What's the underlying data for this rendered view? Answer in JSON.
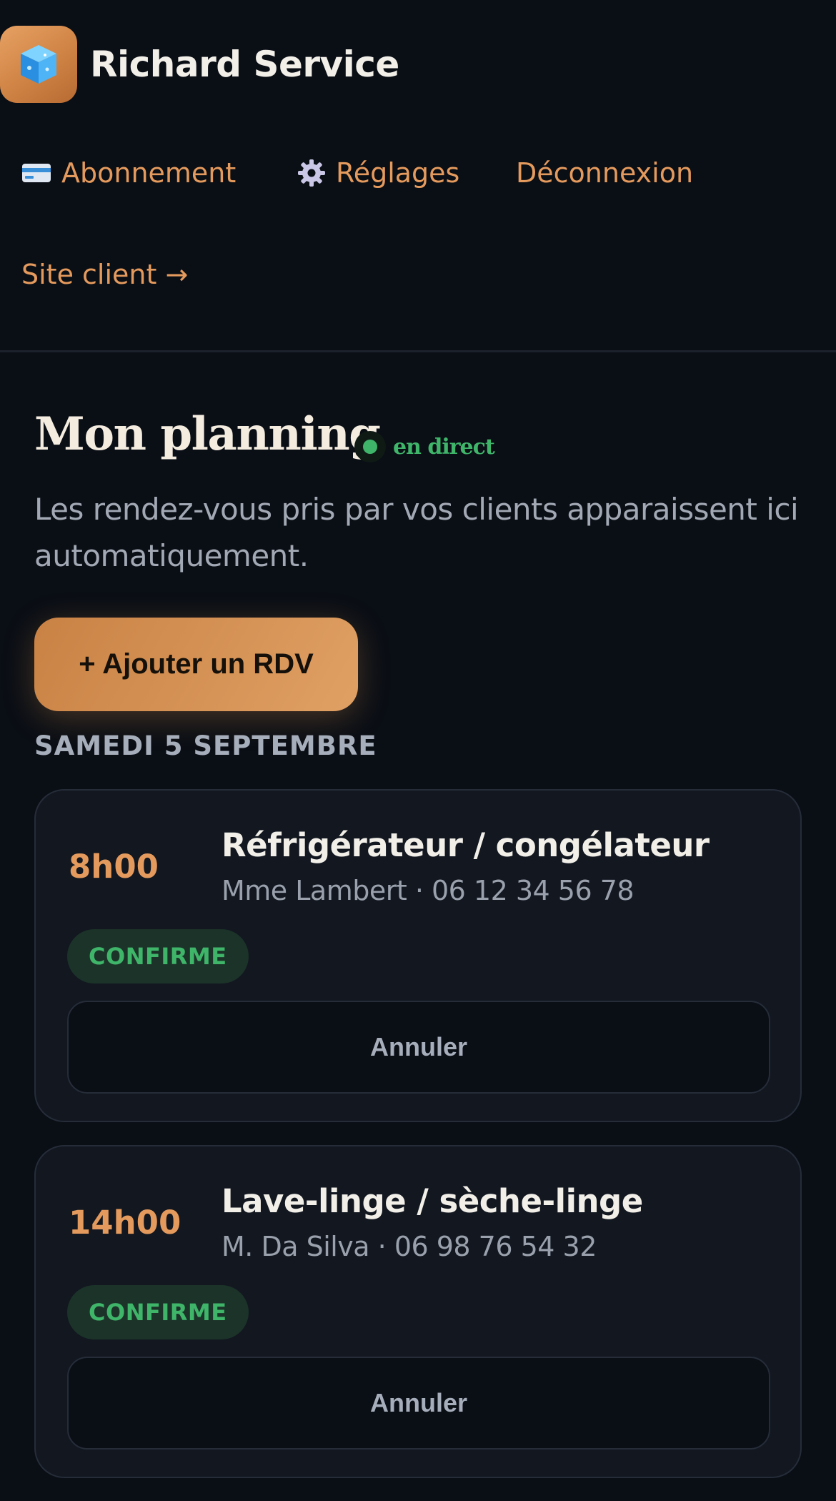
{
  "app": {
    "name": "Richard Service",
    "logo_icon": "ice-cube-icon"
  },
  "nav": {
    "abonnement": {
      "label": "Abonnement",
      "icon": "credit-card-icon"
    },
    "reglages": {
      "label": "Réglages",
      "icon": "gear-icon"
    },
    "deconnexion": {
      "label": "Déconnexion"
    },
    "site_client": {
      "label": "Site client →"
    }
  },
  "planning": {
    "title": "Mon planning",
    "live_label": "en direct",
    "subtitle": "Les rendez-vous pris par vos clients apparaissent ici automatiquement.",
    "add_button_label": "+ Ajouter un RDV",
    "day_label": "SAMEDI 5 SEPTEMBRE"
  },
  "appointments": [
    {
      "time": "8h00",
      "title": "Réfrigérateur / congélateur",
      "client": "Mme Lambert · 06 12 34 56 78",
      "status": "CONFIRME",
      "cancel_label": "Annuler"
    },
    {
      "time": "14h00",
      "title": "Lave-linge / sèche-linge",
      "client": "M. Da Silva · 06 98 76 54 32",
      "status": "CONFIRME",
      "cancel_label": "Annuler"
    }
  ],
  "colors": {
    "background": "#0a0e15",
    "accent": "#e49a5d",
    "success": "#3fb56a",
    "card": "#121720",
    "muted_text": "#a7aebb"
  }
}
